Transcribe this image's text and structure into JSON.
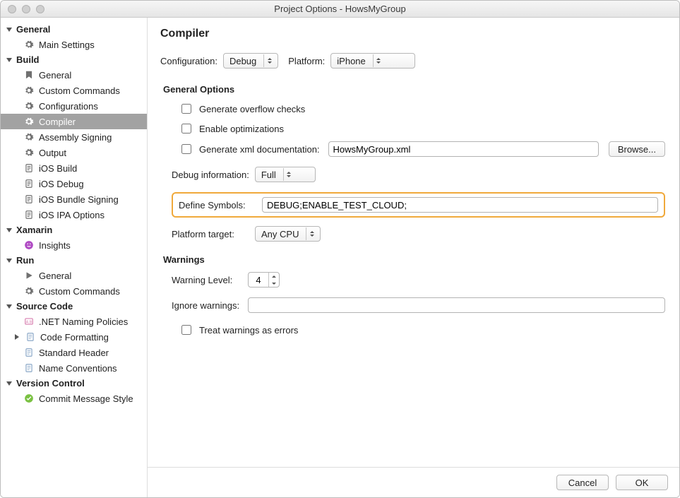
{
  "window": {
    "title": "Project Options - HowsMyGroup"
  },
  "sidebar": {
    "sections": [
      {
        "label": "General",
        "items": [
          {
            "label": "Main Settings",
            "icon": "gear"
          }
        ]
      },
      {
        "label": "Build",
        "items": [
          {
            "label": "General",
            "icon": "flag"
          },
          {
            "label": "Custom Commands",
            "icon": "gear"
          },
          {
            "label": "Configurations",
            "icon": "gear"
          },
          {
            "label": "Compiler",
            "icon": "gear",
            "selected": true
          },
          {
            "label": "Assembly Signing",
            "icon": "gear"
          },
          {
            "label": "Output",
            "icon": "gear"
          },
          {
            "label": "iOS Build",
            "icon": "doc"
          },
          {
            "label": "iOS Debug",
            "icon": "doc"
          },
          {
            "label": "iOS Bundle Signing",
            "icon": "doc"
          },
          {
            "label": "iOS IPA Options",
            "icon": "doc"
          }
        ]
      },
      {
        "label": "Xamarin",
        "items": [
          {
            "label": "Insights",
            "icon": "purple"
          }
        ]
      },
      {
        "label": "Run",
        "items": [
          {
            "label": "General",
            "icon": "play"
          },
          {
            "label": "Custom Commands",
            "icon": "gear"
          }
        ]
      },
      {
        "label": "Source Code",
        "items": [
          {
            "label": ".NET Naming Policies",
            "icon": "abox"
          },
          {
            "label": "Code Formatting",
            "icon": "pagei",
            "expandable": true
          },
          {
            "label": "Standard Header",
            "icon": "pagei"
          },
          {
            "label": "Name Conventions",
            "icon": "pagei"
          }
        ]
      },
      {
        "label": "Version Control",
        "items": [
          {
            "label": "Commit Message Style",
            "icon": "tick"
          }
        ]
      }
    ]
  },
  "page": {
    "title": "Compiler",
    "configuration_label": "Configuration:",
    "configuration_value": "Debug",
    "platform_label": "Platform:",
    "platform_value": "iPhone",
    "general_options_head": "General Options",
    "opt_overflow": "Generate overflow checks",
    "opt_optimize": "Enable optimizations",
    "opt_xmldoc": "Generate xml documentation:",
    "xmldoc_value": "HowsMyGroup.xml",
    "browse_label": "Browse...",
    "debuginfo_label": "Debug information:",
    "debuginfo_value": "Full",
    "define_label": "Define Symbols:",
    "define_value": "DEBUG;ENABLE_TEST_CLOUD;",
    "platform_target_label": "Platform target:",
    "platform_target_value": "Any CPU",
    "warnings_head": "Warnings",
    "warning_level_label": "Warning Level:",
    "warning_level_value": "4",
    "ignore_warnings_label": "Ignore warnings:",
    "ignore_warnings_value": "",
    "treat_warnings_label": "Treat warnings as errors"
  },
  "footer": {
    "cancel": "Cancel",
    "ok": "OK"
  }
}
